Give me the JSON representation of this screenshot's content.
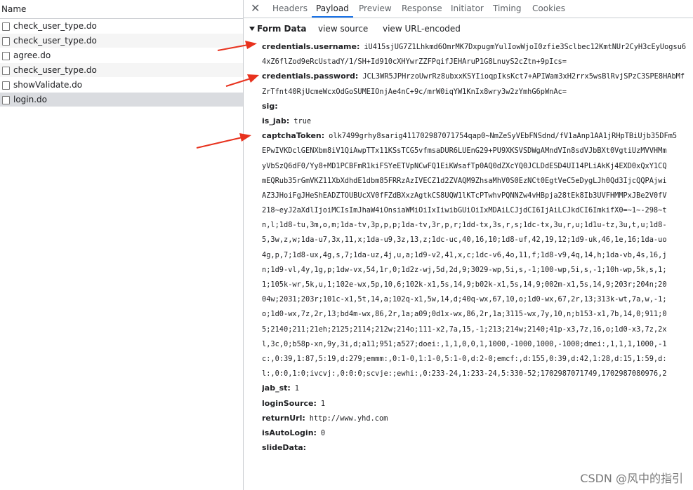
{
  "left_panel": {
    "column_header": "Name",
    "requests": [
      {
        "name": "check_user_type.do"
      },
      {
        "name": "check_user_type.do"
      },
      {
        "name": "agree.do"
      },
      {
        "name": "check_user_type.do"
      },
      {
        "name": "showValidate.do"
      },
      {
        "name": "login.do"
      }
    ]
  },
  "tabs": [
    {
      "label": "Headers"
    },
    {
      "label": "Payload"
    },
    {
      "label": "Preview"
    },
    {
      "label": "Response"
    },
    {
      "label": "Initiator"
    },
    {
      "label": "Timing"
    },
    {
      "label": "Cookies"
    }
  ],
  "close_icon": "✕",
  "form_data": {
    "title": "Form Data",
    "view_source": "view source",
    "view_url_encoded": "view URL-encoded"
  },
  "lines": [
    {
      "key": "credentials.username:",
      "value": "iU415sjUG7Z1Lhkmd6OmrMK7DxpugmYulIowWjoI0zfie3Sclbec12KmtNUr2CyH3cEyUogsu6"
    },
    {
      "cont": "4xZ6flZod9eRcUstadY/1/SH+Id910cXHYwrZZFPqifJEHAruP1G8LnuyS2cZtn+9pIcs="
    },
    {
      "key": "credentials.password:",
      "value": "JCL3WR5JPHrzoUwrRz8ubxxKSYIioqpIksKct7+APIWam3xH2rrx5wsBlRvjSPzC3SPE8HAbMf"
    },
    {
      "cont": "ZrTfnt40RjUcmeWcxOdGoSUMEIOnjAe4nC+9c/mrW0iqYW1KnIx8wry3w2zYmhG6pWnAc="
    },
    {
      "key": "sig:",
      "value": ""
    },
    {
      "key": "is_jab:",
      "value": "true"
    },
    {
      "key": "captchaToken:",
      "value": "olk7499grhy8sarig411702987071754qap0~NmZeSyVEbFNSdnd/fV1aAnp1AA1jRHpTBiUjb35DFm5"
    },
    {
      "cont": "EPwIVKDclGENXbm8iV1QiAwpTTx11KSsTCG5vfmsaDUR6LUEnG29+PU9XKSVSDWgAMndVIn8sdVJbBXt0VgtiUzMVVHMm"
    },
    {
      "cont": "yVbSzQ6dF0/Yy8+MD1PCBFmR1kiFSYeETVpNCwFQ1EiKWsafTp0AQ0dZXcYQ0JCLDdESD4UI14PLiAkKj4EXD0xQxY1CQ"
    },
    {
      "cont": "mEQRub35rGmVKZ11XbXdhdE1dbm85FRRzAzIVECZ1d2ZVAQM9ZhsaMhV0S0EzNCt0EgtVeC5eDygLJh0Qd3IjcQQPAjwi"
    },
    {
      "cont": "AZ3JHoiFgJHeShEADZTOUBUcXV0fFZdBXxzAgtkCS8UQW1lKTcPTwhvPQNNZw4vHBpja28tEk8Ib3UVFHMMPxJBe2V0fV"
    },
    {
      "cont": "218~eyJ2aXdlIjoiMCIsImJhaW4iOnsiaWMiOiIxIiwibGUiOiIxMDAiLCJjdCI6IjAiLCJkdCI6ImkifX0=~1~-298~t"
    },
    {
      "cont": "n,l;1d8-tu,3m,o,m;1da-tv,3p,p,p;1da-tv,3r,p,r;1dd-tx,3s,r,s;1dc-tx,3u,r,u;1d1u-tz,3u,t,u;1d8-"
    },
    {
      "cont": "5,3w,z,w;1da-u7,3x,11,x;1da-u9,3z,13,z;1dc-uc,40,16,10;1d8-uf,42,19,12;1d9-uk,46,1e,16;1da-uo"
    },
    {
      "cont": "4g,p,7;1d8-ux,4g,s,7;1da-uz,4j,u,a;1d9-v2,41,x,c;1dc-v6,4o,11,f;1d8-v9,4q,14,h;1da-vb,4s,16,j"
    },
    {
      "cont": "n;1d9-vl,4y,1g,p;1dw-vx,54,1r,0;1d2z-wj,5d,2d,9;3029-wp,5i,s,-1;100-wp,5i,s,-1;10h-wp,5k,s,1;"
    },
    {
      "cont": "1;105k-wr,5k,u,1;102e-wx,5p,10,6;102k-x1,5s,14,9;b02k-x1,5s,14,9;002m-x1,5s,14,9;203r;204n;20"
    },
    {
      "cont": "04w;2031;203r;101c-x1,5t,14,a;102q-x1,5w,14,d;40q-wx,67,10,o;1d0-wx,67,2r,13;313k-wt,7a,w,-1;"
    },
    {
      "cont": "o;1d0-wx,7z,2r,13;bd4m-wx,86,2r,1a;a09;0d1x-wx,86,2r,1a;3115-wx,7y,10,n;b153-x1,7b,14,0;911;0"
    },
    {
      "cont": "5;2140;211;21eh;2125;2114;212w;214o;111-x2,7a,15,-1;213;214w;2140;41p-x3,7z,16,o;1d0-x3,7z,2x"
    },
    {
      "cont": "l,3c,0;b58p-xn,9y,3i,d;a11;951;a527;doei:,1,1,0,0,1,1000,-1000,1000,-1000;dmei:,1,1,1,1000,-1"
    },
    {
      "cont": "c:,0:39,1:87,5:19,d:279;emmm:,0:1-0,1:1-0,5:1-0,d:2-0;emcf:,d:155,0:39,d:42,1:28,d:15,1:59,d:"
    },
    {
      "cont": "l:,0:0,1:0;ivcvj:,0:0:0;scvje:;ewhi:,0:233-24,1:233-24,5:330-52;1702987071749,1702987080976,2"
    },
    {
      "key": "jab_st:",
      "value": "1"
    },
    {
      "key": "loginSource:",
      "value": "1"
    },
    {
      "key": "returnUrl:",
      "value": "http://www.yhd.com"
    },
    {
      "key": "isAutoLogin:",
      "value": "0"
    },
    {
      "key": "slideData:",
      "value": ""
    }
  ],
  "watermark": "CSDN @风中的指引",
  "colors": {
    "annotation_arrow": "#e8321e",
    "active_tab_underline": "#1a73e8",
    "selected_row": "#dadce0"
  }
}
